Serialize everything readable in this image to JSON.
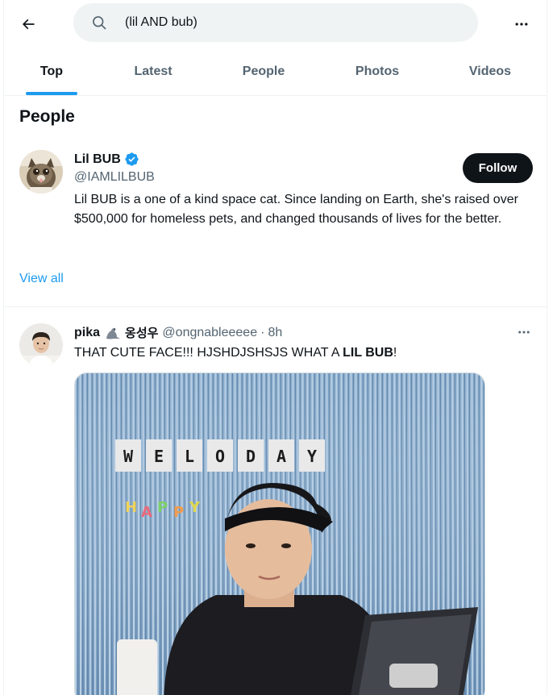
{
  "header": {
    "back_icon": "arrow-left-icon",
    "search_icon": "search-icon",
    "search_query": "(lil AND bub)",
    "more_icon": "more-horizontal-icon"
  },
  "tabs": [
    {
      "label": "Top",
      "active": true
    },
    {
      "label": "Latest",
      "active": false
    },
    {
      "label": "People",
      "active": false
    },
    {
      "label": "Photos",
      "active": false
    },
    {
      "label": "Videos",
      "active": false
    }
  ],
  "people_section": {
    "title": "People",
    "user": {
      "avatar": "cat-avatar",
      "name": "Lil BUB",
      "verified": true,
      "handle": "@IAMLILBUB",
      "follow_label": "Follow",
      "bio": "Lil BUB is a one of a kind space cat. Since landing on Earth, she's raised over $500,000 for homeless pets, and changed thousands of lives for the better."
    },
    "view_all": "View all"
  },
  "tweet": {
    "avatar": "person-avatar",
    "author": "pika",
    "author_emoji": "seal-icon",
    "author_korean": "옹성우",
    "handle": "@ongnableeeee",
    "dot": "·",
    "time": "8h",
    "text_prefix": "THAT CUTE FACE!!! HJSHDJSHSJS WHAT A ",
    "text_bold": "LIL BUB",
    "text_suffix": "!",
    "media": {
      "sign_letters": [
        "W",
        "E",
        "L",
        "O",
        "D",
        "A",
        "Y"
      ],
      "banner_letters": [
        "H",
        "A",
        "P",
        "P",
        "Y"
      ]
    }
  },
  "colors": {
    "accent": "#1d9bf0",
    "text_primary": "#0f1419",
    "text_secondary": "#536471",
    "search_bg": "#eff3f4"
  }
}
